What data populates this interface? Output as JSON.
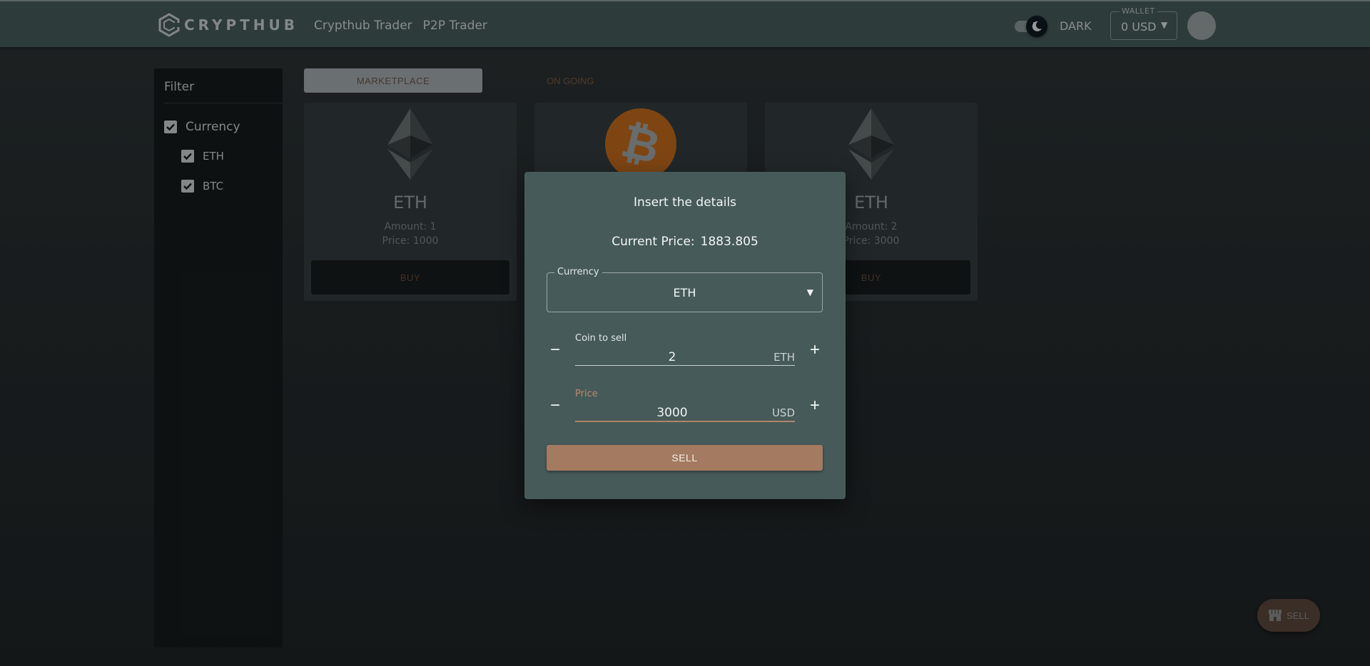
{
  "header": {
    "logo_text": "CRYPTHUB",
    "nav": [
      "Crypthub Trader",
      "P2P Trader"
    ],
    "theme_label": "DARK",
    "wallet_label": "WALLET",
    "wallet_value": "0 USD"
  },
  "sidebar": {
    "title": "Filter",
    "filters": [
      {
        "label": "Currency",
        "checked": true
      },
      {
        "label": "ETH",
        "checked": true
      },
      {
        "label": "BTC",
        "checked": true
      }
    ]
  },
  "tabs": {
    "marketplace": "MARKETPLACE",
    "ongoing": "ON GOING"
  },
  "cards": [
    {
      "name": "ETH",
      "amount": "Amount: 1",
      "price": "Price: 1000",
      "button": "BUY",
      "icon": "ethereum-icon"
    },
    {
      "name": "BTC",
      "icon": "bitcoin-icon"
    },
    {
      "name": "ETH",
      "amount": "Amount: 2",
      "price": "Price: 3000",
      "button": "BUY",
      "icon": "ethereum-icon"
    }
  ],
  "dialog": {
    "title": "Insert the details",
    "current_price_label": "Current Price:",
    "current_price_value": "1883.805",
    "currency_label": "Currency",
    "currency_value": "ETH",
    "coin_label": "Coin to sell",
    "coin_value": "2",
    "coin_unit": "ETH",
    "price_label": "Price",
    "price_value": "3000",
    "price_unit": "USD",
    "sell_button": "SELL"
  },
  "fab": {
    "label": "SELL",
    "icon": "store-icon"
  },
  "colors": {
    "accent": "#a47a60",
    "header_bg": "#485b5b",
    "dialog_bg": "#475a5a",
    "bitcoin": "#f7931a"
  }
}
